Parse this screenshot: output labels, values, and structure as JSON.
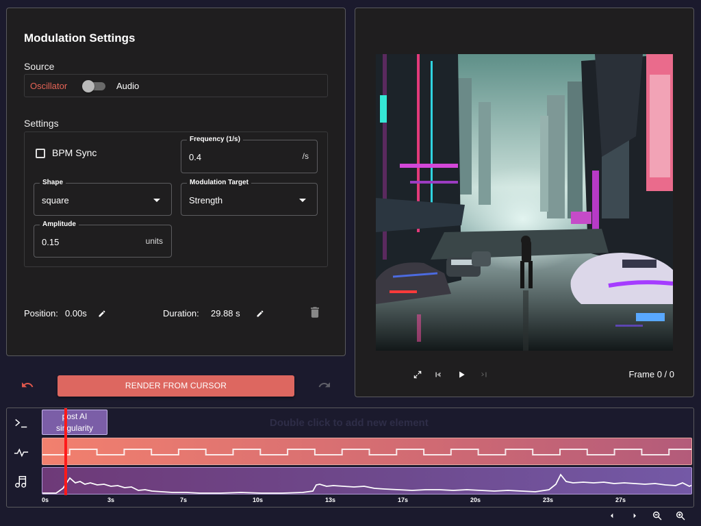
{
  "settings": {
    "title": "Modulation Settings",
    "source_label": "Source",
    "source_left": "Oscillator",
    "source_right": "Audio",
    "source_toggle_on": false,
    "settings_label": "Settings",
    "bpm_sync_label": "BPM Sync",
    "bpm_sync_checked": false,
    "frequency": {
      "label": "Frequency (1/s)",
      "value": "0.4",
      "unit": "/s"
    },
    "shape": {
      "label": "Shape",
      "value": "square"
    },
    "target": {
      "label": "Modulation Target",
      "value": "Strength"
    },
    "amplitude": {
      "label": "Amplitude",
      "value": "0.15",
      "unit": "units"
    },
    "position_label": "Position:",
    "position_value": "0.00s",
    "duration_label": "Duration:",
    "duration_value": "29.88 s"
  },
  "actions": {
    "render_label": "RENDER FROM CURSOR"
  },
  "preview": {
    "frame_label": "Frame 0 / 0"
  },
  "timeline": {
    "hint": "Double click to add new element",
    "clip_label": "post AI singularity",
    "ticks": [
      "0s",
      "3s",
      "7s",
      "10s",
      "13s",
      "17s",
      "20s",
      "23s",
      "27s"
    ]
  },
  "icons": {
    "prompt": "terminal-icon",
    "oscillator": "waveform-icon",
    "audio": "music-note-icon",
    "undo": "undo-icon",
    "redo": "redo-icon",
    "fullscreen": "expand-icon",
    "skip_start": "skip-start-icon",
    "play": "play-icon",
    "skip_end": "skip-end-icon",
    "edit": "pencil-icon",
    "delete": "trash-icon",
    "scroll_left": "chevron-left-icon",
    "scroll_right": "chevron-right-icon",
    "zoom_out": "zoom-out-icon",
    "zoom_in": "zoom-in-icon"
  },
  "colors": {
    "accent": "#dd6760",
    "oscillator_track": "#f2806e",
    "audio_track": "#6e4a8e",
    "playhead": "#ff1a1a"
  }
}
